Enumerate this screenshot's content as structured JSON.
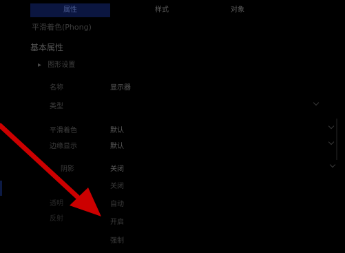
{
  "tabs": [
    {
      "label": "属性"
    },
    {
      "label": "样式"
    },
    {
      "label": "对象"
    }
  ],
  "subtitle": "平滑着色(Phong)",
  "section": {
    "title": "基本属性",
    "group_title": "图形设置",
    "fields": [
      {
        "label": "名称",
        "value": "显示器"
      },
      {
        "label": "类型",
        "value": ""
      },
      {
        "label": "平滑着色",
        "value": "默认"
      },
      {
        "label": "边缘显示",
        "value": "默认"
      },
      {
        "label": "阴影",
        "value": "关闭"
      }
    ]
  },
  "dropdown_options": [
    "关闭",
    "自动",
    "开启",
    "强制"
  ],
  "under_labels": [
    "透明",
    "反射"
  ],
  "colors": {
    "background": "#000000",
    "active_tab": "#0b1640",
    "annotation_arrow": "#cc0000"
  },
  "icons": {
    "group_toggle": "triangle-right-icon",
    "dropdown": "chevron-down-icon",
    "annotation": "red-arrow-annotation"
  }
}
